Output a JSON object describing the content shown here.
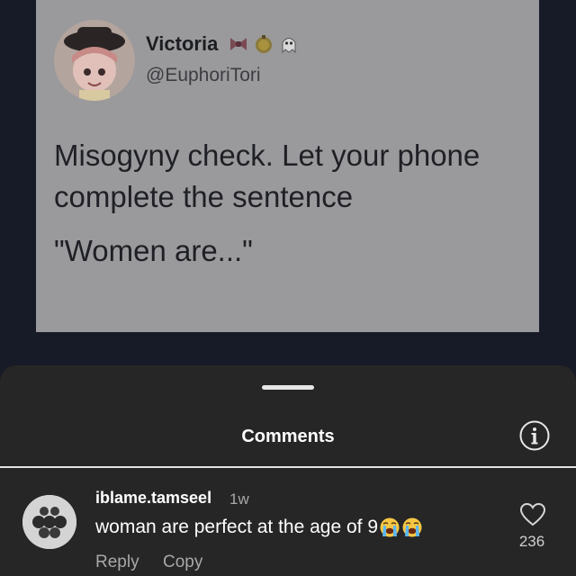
{
  "post": {
    "author_name": "Victoria",
    "author_handle": "@EuphoriTori",
    "text": "Misogyny check. Let your phone complete the sentence",
    "quote": "\"Women are...\"",
    "badge_icons": [
      "bow-icon",
      "coin-icon",
      "ghost-skull-icon"
    ]
  },
  "comments_sheet": {
    "title": "Comments",
    "info_icon": "info-icon",
    "comment": {
      "username": "iblame.tamseel",
      "time": "1w",
      "text": "woman are perfect at the age of 9",
      "emojis": [
        "loudly-crying-face-icon",
        "loudly-crying-face-icon"
      ],
      "reply_label": "Reply",
      "copy_label": "Copy",
      "like_icon": "heart-icon",
      "like_count": "236"
    }
  },
  "colors": {
    "sheet_bg": "#262626",
    "backdrop": "#151a24",
    "tweet_card": "#9a9a9c",
    "secondary_text": "#a8a8a8"
  }
}
